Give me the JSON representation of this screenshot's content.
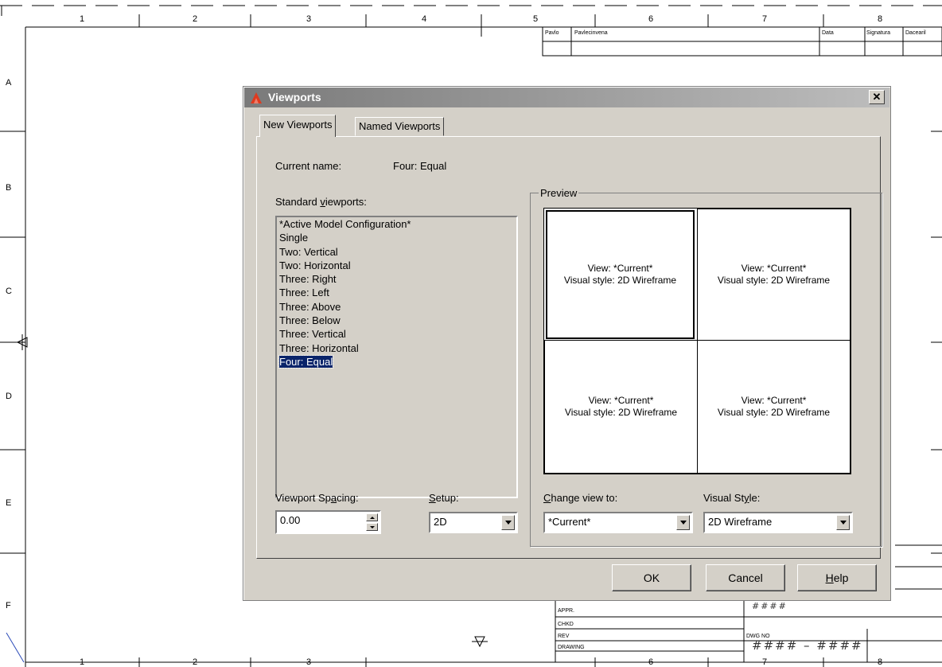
{
  "sheet": {
    "columns": [
      "1",
      "2",
      "3",
      "4",
      "5",
      "6",
      "7",
      "8"
    ],
    "rows": [
      "A",
      "B",
      "C",
      "D",
      "E",
      "F"
    ],
    "title_block_header": [
      "Pavlo",
      "Pavlecinvena",
      "Data",
      "Signatura",
      "Dacearil"
    ],
    "title_block_rows": [
      "APPR.",
      "CHKD",
      "REV",
      "DRAWING"
    ],
    "drawing_label": "DWG NO",
    "drawing_number": "####  –  ####",
    "top_code": "####"
  },
  "dialog": {
    "title": "Viewports",
    "close_label": "✕",
    "tabs": [
      {
        "label": "New Viewports",
        "active": true
      },
      {
        "label": "Named Viewports",
        "active": false
      }
    ],
    "current_name_label": "Current name:",
    "current_name_value": "Four:  Equal",
    "standard_label_pre": "Standard ",
    "standard_label_key": "v",
    "standard_label_post": "iewports:",
    "standard_viewports": [
      "*Active Model Configuration*",
      "Single",
      "Two:  Vertical",
      "Two:  Horizontal",
      "Three: Right",
      "Three: Left",
      "Three: Above",
      "Three: Below",
      "Three: Vertical",
      "Three: Horizontal",
      "Four:  Equal"
    ],
    "selected_viewport": "Four:  Equal",
    "preview_label": "Preview",
    "panes": [
      {
        "view": "View: *Current*",
        "style": "Visual style: 2D Wireframe"
      },
      {
        "view": "View: *Current*",
        "style": "Visual style: 2D Wireframe"
      },
      {
        "view": "View: *Current*",
        "style": "Visual style: 2D Wireframe"
      },
      {
        "view": "View: *Current*",
        "style": "Visual style: 2D Wireframe"
      }
    ],
    "spacing_label_pre": "Viewport Sp",
    "spacing_label_key": "a",
    "spacing_label_post": "cing:",
    "spacing_value": "0.00",
    "setup_label_key": "S",
    "setup_label_post": "etup:",
    "setup_value": "2D",
    "change_view_label_key": "C",
    "change_view_label_post": "hange view to:",
    "change_view_value": "*Current*",
    "visual_style_label_pre": "Visual St",
    "visual_style_label_key": "y",
    "visual_style_label_post": "le:",
    "visual_style_value": "2D Wireframe",
    "ok_label": "OK",
    "cancel_label": "Cancel",
    "help_label_key": "H",
    "help_label_post": "elp"
  }
}
